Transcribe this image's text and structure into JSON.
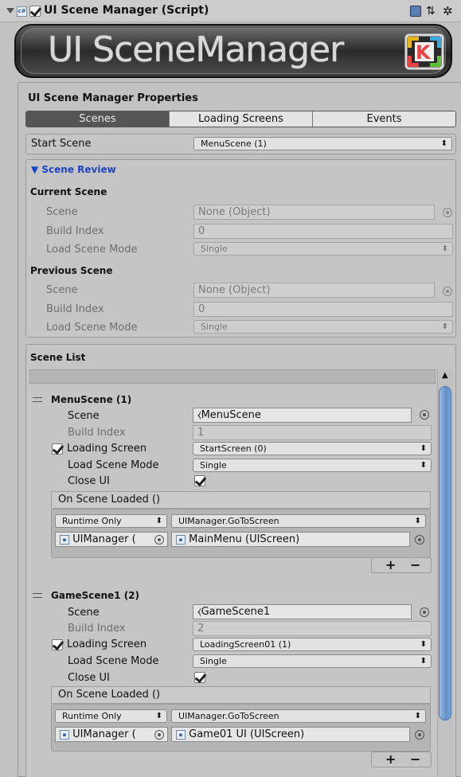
{
  "header": {
    "title": "UI Scene Manager (Script)",
    "banner_text": "UI SceneManager",
    "logo_letter": "K"
  },
  "properties_title": "UI Scene Manager Properties",
  "tabs": [
    {
      "label": "Scenes",
      "active": true
    },
    {
      "label": "Loading Screens",
      "active": false
    },
    {
      "label": "Events",
      "active": false
    }
  ],
  "start_scene": {
    "label": "Start Scene",
    "value": "MenuScene (1)"
  },
  "scene_review": {
    "foldout": "Scene Review",
    "current": {
      "heading": "Current Scene",
      "scene_label": "Scene",
      "scene_value": "None (Object)",
      "build_label": "Build Index",
      "build_value": "0",
      "mode_label": "Load Scene Mode",
      "mode_value": "Single"
    },
    "previous": {
      "heading": "Previous Scene",
      "scene_label": "Scene",
      "scene_value": "None (Object)",
      "build_label": "Build Index",
      "build_value": "0",
      "mode_label": "Load Scene Mode",
      "mode_value": "Single"
    }
  },
  "scene_list": {
    "title": "Scene List",
    "items": [
      {
        "name": "MenuScene (1)",
        "scene_label": "Scene",
        "scene_value": "MenuScene",
        "build_label": "Build Index",
        "build_value": "1",
        "loading_label": "Loading Screen",
        "loading_value": "StartScreen (0)",
        "mode_label": "Load Scene Mode",
        "mode_value": "Single",
        "close_label": "Close UI",
        "event_title": "On Scene Loaded ()",
        "runtime_value": "Runtime Only",
        "function_value": "UIManager.GoToScreen",
        "object_value": "UIManager (",
        "arg_value": "MainMenu (UIScreen)"
      },
      {
        "name": "GameScene1 (2)",
        "scene_label": "Scene",
        "scene_value": "GameScene1",
        "build_label": "Build Index",
        "build_value": "2",
        "loading_label": "Loading Screen",
        "loading_value": "LoadingScreen01 (1)",
        "mode_label": "Load Scene Mode",
        "mode_value": "Single",
        "close_label": "Close UI",
        "event_title": "On Scene Loaded ()",
        "runtime_value": "Runtime Only",
        "function_value": "UIManager.GoToScreen",
        "object_value": "UIManager (",
        "arg_value": "Game01 UI (UIScreen)"
      }
    ],
    "plus": "+",
    "minus": "−"
  },
  "colors": {
    "accent": "#1a44c8",
    "active_tab": "#555555",
    "scroll_thumb": "#5f8fc8"
  }
}
